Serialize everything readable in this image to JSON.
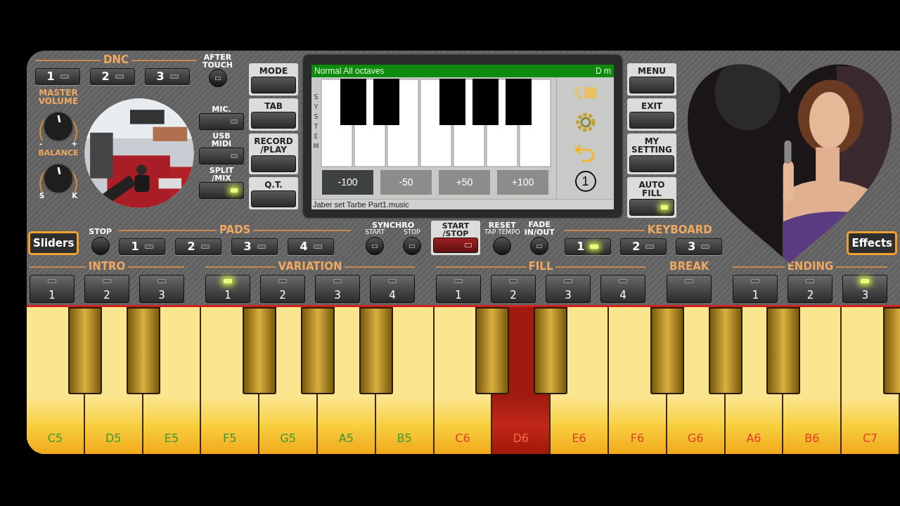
{
  "dnc": {
    "label": "DNC",
    "buttons": [
      {
        "label": "1",
        "lit": false
      },
      {
        "label": "2",
        "lit": false
      },
      {
        "label": "3",
        "lit": false
      }
    ]
  },
  "after_touch": {
    "label": "AFTER TOUCH"
  },
  "master_volume": {
    "label": "MASTER VOLUME",
    "min": "-",
    "max": "+"
  },
  "balance": {
    "label": "BALANCE",
    "min": "S",
    "max": "K"
  },
  "left_switches": [
    {
      "label": "MIC.",
      "lit": false
    },
    {
      "label": "USB MIDI",
      "lit": false
    },
    {
      "label": "SPLIT /MIX",
      "lit": true
    }
  ],
  "mode_buttons": [
    {
      "label": "MODE"
    },
    {
      "label": "TAB"
    },
    {
      "label": "RECORD /PLAY"
    },
    {
      "label": "Q.T."
    }
  ],
  "display": {
    "title": "Normal All octaves",
    "chord": "D m",
    "side_label": "SYSTEM",
    "preset_number": "1",
    "file": "Jaber set Tarbe Part1.music",
    "tune_buttons": [
      {
        "label": "-100",
        "selected": true
      },
      {
        "label": "-50",
        "selected": false
      },
      {
        "label": "+50",
        "selected": false
      },
      {
        "label": "+100",
        "selected": false
      }
    ]
  },
  "right_buttons": [
    {
      "label": "MENU"
    },
    {
      "label": "EXIT"
    },
    {
      "label": "MY SETTING"
    },
    {
      "label": "AUTO FILL",
      "lit": true
    }
  ],
  "sliders_button": "Sliders",
  "pads": {
    "label": "PADS",
    "stop": "STOP",
    "buttons": [
      {
        "label": "1",
        "lit": false
      },
      {
        "label": "2",
        "lit": false
      },
      {
        "label": "3",
        "lit": false
      },
      {
        "label": "4",
        "lit": false
      }
    ]
  },
  "synchro": {
    "label": "SYNCHRO",
    "start": "START",
    "stop": "STOP"
  },
  "start_stop": {
    "label": "START /STOP"
  },
  "reset": {
    "label": "RESET",
    "sub": "TAP TEMPO"
  },
  "fade": {
    "label": "FADE IN/OUT"
  },
  "keyboard_set": {
    "label": "KEYBOARD",
    "buttons": [
      {
        "label": "1",
        "lit": true
      },
      {
        "label": "2",
        "lit": false
      },
      {
        "label": "3",
        "lit": false
      }
    ]
  },
  "effects_button": "Effects",
  "sections": [
    {
      "label": "INTRO",
      "buttons": [
        {
          "label": "1",
          "lit": false
        },
        {
          "label": "2",
          "lit": false
        },
        {
          "label": "3",
          "lit": false
        }
      ]
    },
    {
      "label": "VARIATION",
      "buttons": [
        {
          "label": "1",
          "lit": true
        },
        {
          "label": "2",
          "lit": false
        },
        {
          "label": "3",
          "lit": false
        },
        {
          "label": "4",
          "lit": false
        }
      ]
    },
    {
      "label": "FILL",
      "buttons": [
        {
          "label": "1",
          "lit": false
        },
        {
          "label": "2",
          "lit": false
        },
        {
          "label": "3",
          "lit": false
        },
        {
          "label": "4",
          "lit": false
        }
      ]
    },
    {
      "label": "BREAK",
      "buttons": [
        {
          "lit": false
        }
      ]
    },
    {
      "label": "ENDING",
      "buttons": [
        {
          "label": "1",
          "lit": false
        },
        {
          "label": "2",
          "lit": false
        },
        {
          "label": "3",
          "lit": true
        }
      ]
    }
  ],
  "keys": [
    {
      "note": "C5",
      "pressed": false,
      "sharp": true
    },
    {
      "note": "D5",
      "pressed": false,
      "sharp": true
    },
    {
      "note": "E5",
      "pressed": false,
      "sharp": false
    },
    {
      "note": "F5",
      "pressed": false,
      "sharp": true
    },
    {
      "note": "G5",
      "pressed": false,
      "sharp": true
    },
    {
      "note": "A5",
      "pressed": false,
      "sharp": true
    },
    {
      "note": "B5",
      "pressed": false,
      "sharp": false
    },
    {
      "note": "C6",
      "pressed": false,
      "sharp": true
    },
    {
      "note": "D6",
      "pressed": true,
      "sharp": true
    },
    {
      "note": "E6",
      "pressed": false,
      "sharp": false
    },
    {
      "note": "F6",
      "pressed": false,
      "sharp": true
    },
    {
      "note": "G6",
      "pressed": false,
      "sharp": true
    },
    {
      "note": "A6",
      "pressed": false,
      "sharp": true
    },
    {
      "note": "B6",
      "pressed": false,
      "sharp": false
    },
    {
      "note": "C7",
      "pressed": false,
      "sharp": true
    }
  ]
}
